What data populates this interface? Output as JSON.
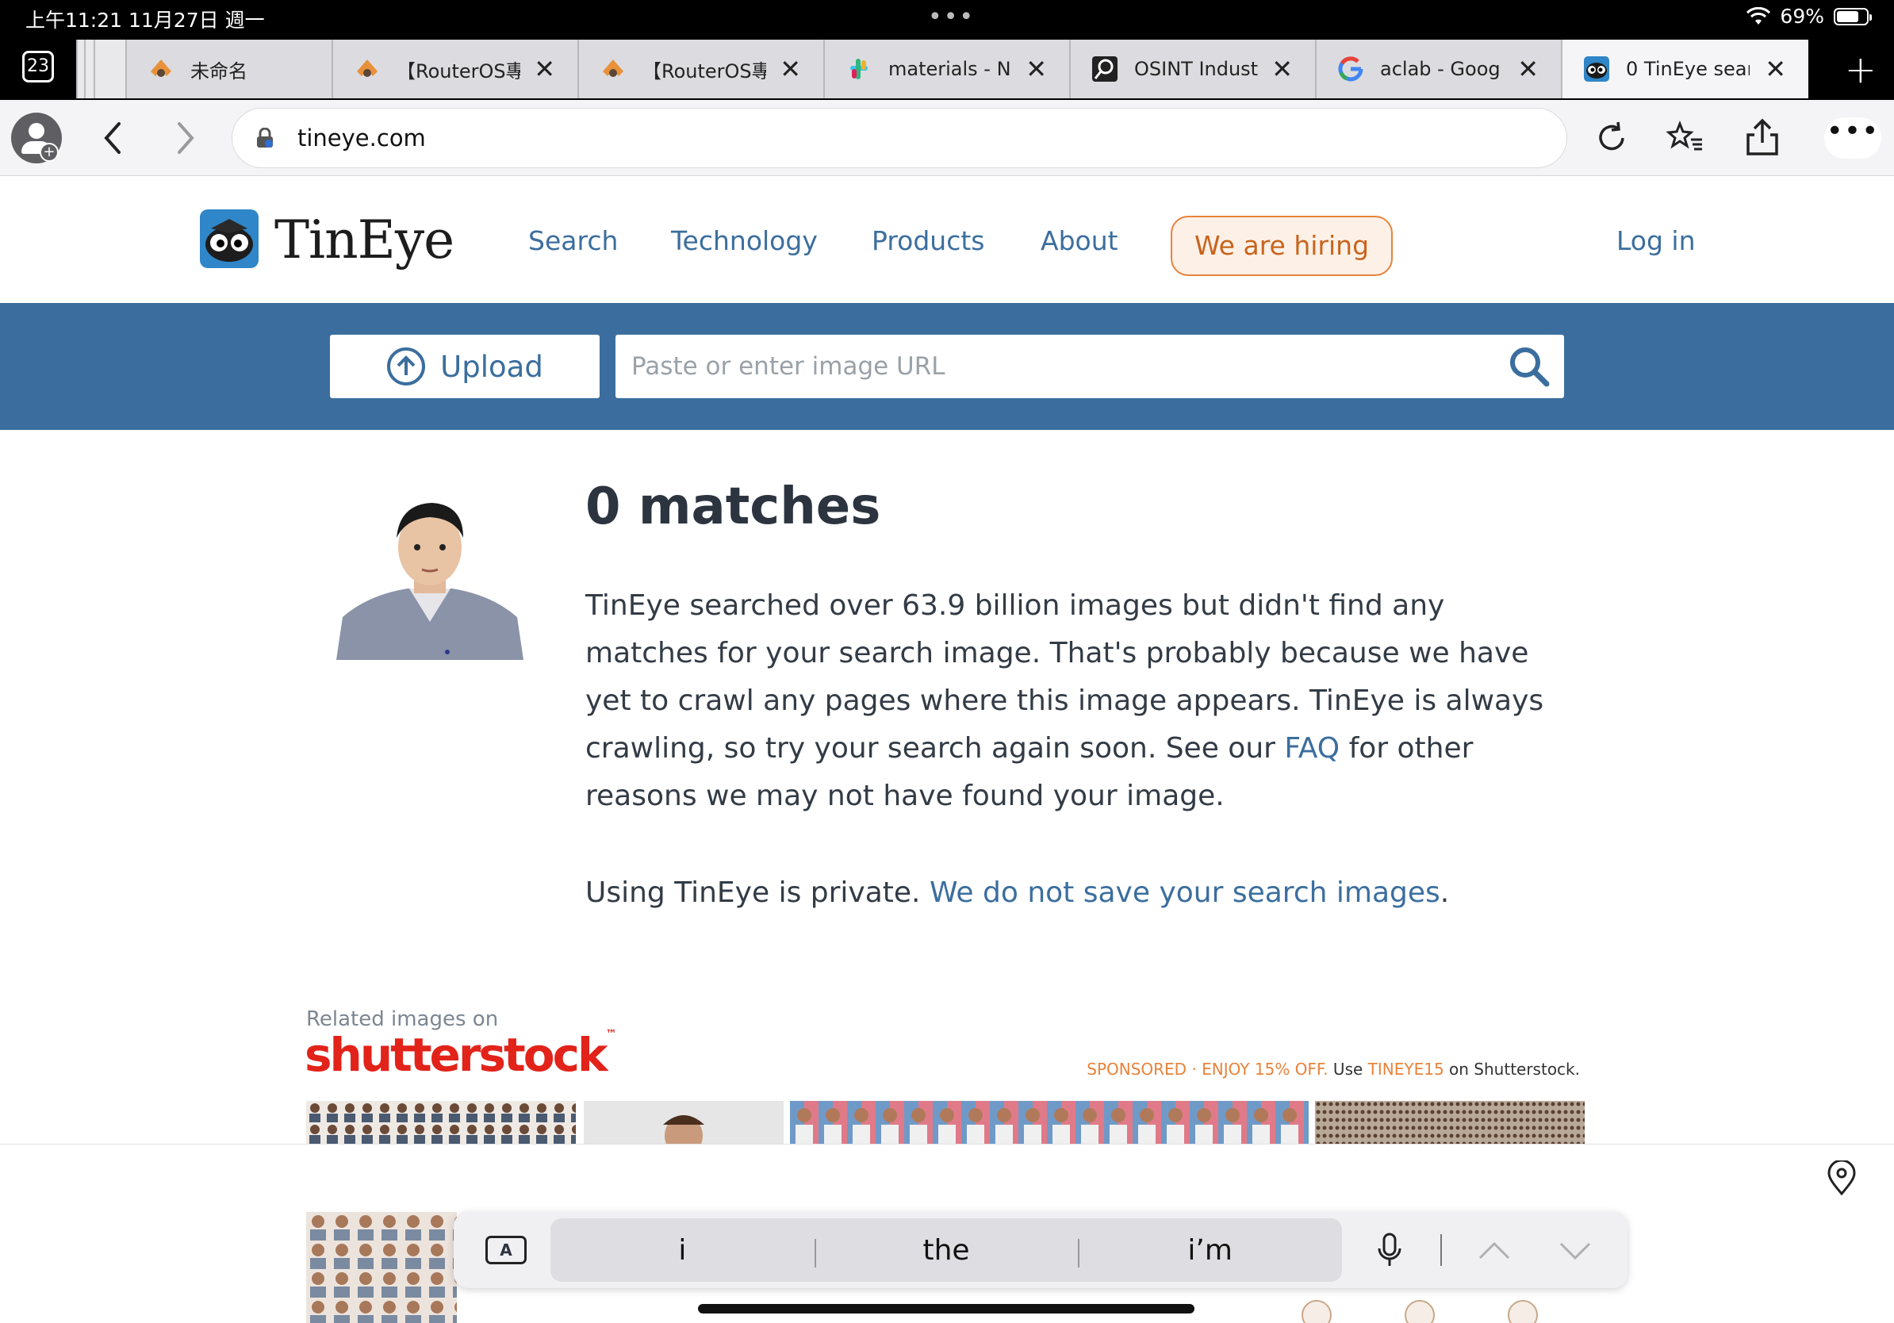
{
  "status": {
    "time": "上午11:21 11月27日 週一",
    "dots": "•••",
    "battery": "69%"
  },
  "tabs": {
    "count": "23",
    "items": [
      {
        "title": "未命名",
        "favicon": "mikrotik-icon",
        "active": false
      },
      {
        "title": "【RouterOS專",
        "favicon": "mikrotik-icon",
        "active": false
      },
      {
        "title": "【RouterOS專",
        "favicon": "mikrotik-icon",
        "active": false
      },
      {
        "title": "materials - N",
        "favicon": "slack-icon",
        "active": false
      },
      {
        "title": "OSINT Indust",
        "favicon": "osint-icon",
        "active": false
      },
      {
        "title": "aclab - Goog",
        "favicon": "google-icon",
        "active": false
      },
      {
        "title": "0 TinEye sear",
        "favicon": "tineye-icon",
        "active": true
      }
    ],
    "close_glyph": "✕",
    "new_tab_glyph": "+"
  },
  "toolbar": {
    "url": "tineye.com",
    "more_glyph": "•••"
  },
  "site": {
    "logo_text": "TinEye",
    "nav": {
      "search": "Search",
      "technology": "Technology",
      "products": "Products",
      "about": "About",
      "hiring": "We are hiring",
      "login": "Log in"
    },
    "upload_label": "Upload",
    "url_placeholder": "Paste or enter image URL"
  },
  "results": {
    "heading": "0 matches",
    "para_1": "TinEye searched over 63.9 billion images but didn't find any matches for your search image. That's probably because we have yet to crawl any pages where this image appears. TinEye is always crawling, so try your search again soon. See our ",
    "faq_link": "FAQ",
    "para_2": " for other reasons we may not have found your image.",
    "privacy_text": "Using TinEye is private. ",
    "privacy_link": "We do not save your search images",
    "privacy_end": "."
  },
  "shutterstock": {
    "related": "Related images on",
    "logo": "shutterstock",
    "sponsored": "SPONSORED · ENJOY 15% OFF.",
    "use": " Use ",
    "code": "TINEYE15",
    "on": " on Shutterstock."
  },
  "keyboard": {
    "key_a": "A",
    "suggestions": [
      "i",
      "the",
      "i’m"
    ]
  },
  "colors": {
    "tineye_blue": "#3b6e9e",
    "hiring_orange": "#e8833a",
    "shutterstock_red": "#e2231a"
  }
}
